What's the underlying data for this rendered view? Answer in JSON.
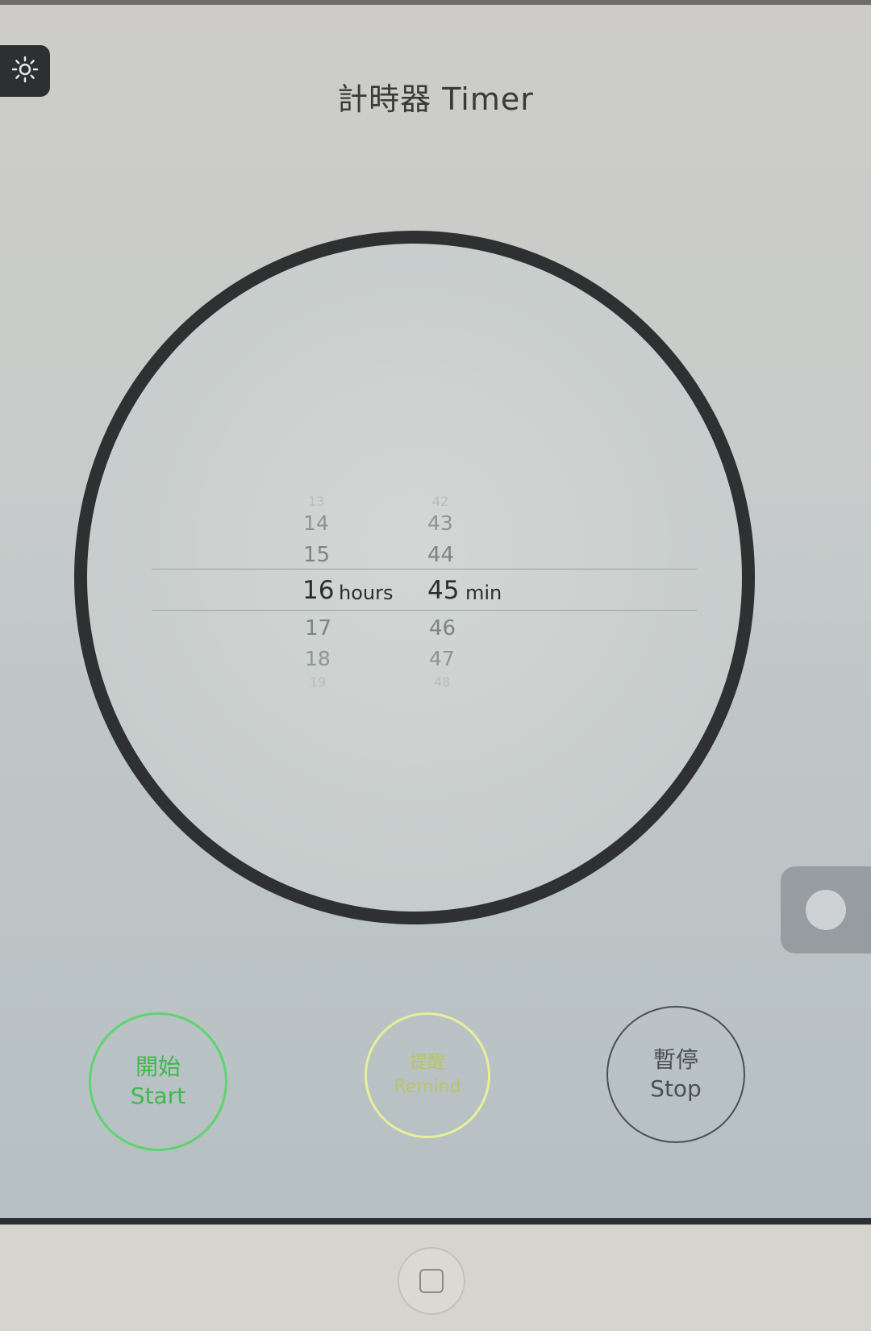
{
  "header": {
    "title": "計時器 Timer",
    "settings_icon": "brightness-icon"
  },
  "picker": {
    "hours": {
      "values": [
        "13",
        "14",
        "15",
        "16",
        "17",
        "18",
        "19"
      ],
      "selected": "16",
      "unit": "hours"
    },
    "minutes": {
      "values": [
        "42",
        "43",
        "44",
        "45",
        "46",
        "47",
        "48"
      ],
      "selected": "45",
      "unit": "min"
    }
  },
  "buttons": {
    "start": {
      "label_zh": "開始",
      "label_en": "Start",
      "color": "#5ed46e"
    },
    "remind": {
      "label_zh": "提醒",
      "label_en": "Remind",
      "color": "#e8ef9a"
    },
    "stop": {
      "label_zh": "暫停",
      "label_en": "Stop",
      "color": "#4a4f53"
    }
  },
  "system": {
    "assistive_touch_icon": "assistive-touch-icon",
    "home_icon": "home-button-icon"
  }
}
